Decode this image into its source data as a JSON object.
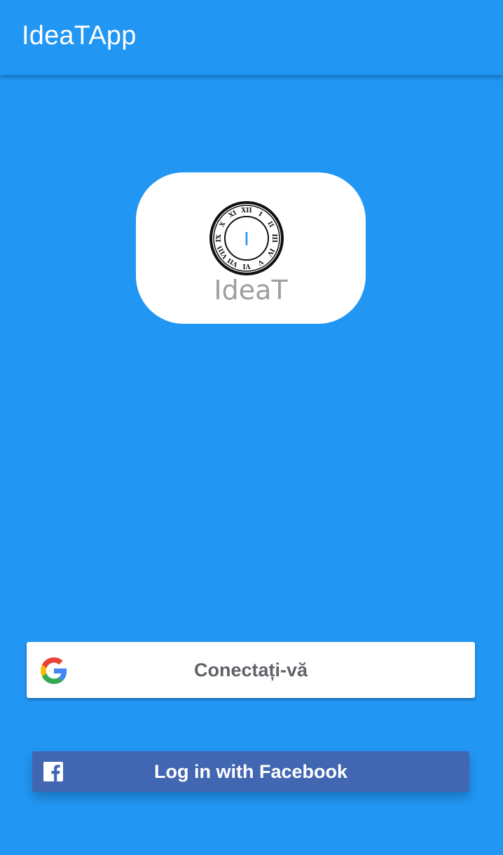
{
  "app_bar": {
    "title": "IdeaTApp"
  },
  "logo": {
    "text": "IdeaT",
    "clock_center_letter": "I",
    "roman_numerals": [
      "XII",
      "I",
      "II",
      "III",
      "IV",
      "V",
      "VI",
      "VII",
      "VIII",
      "IX",
      "X",
      "XI"
    ]
  },
  "google_button": {
    "label": "Conectați-vă",
    "icon": "google-g-icon"
  },
  "facebook_button": {
    "label": "Log in with Facebook",
    "icon": "facebook-f-icon"
  },
  "colors": {
    "background": "#2196F3",
    "facebook": "#4267B2",
    "google_text": "#5f6368",
    "logo_text": "#9e9e9e"
  }
}
